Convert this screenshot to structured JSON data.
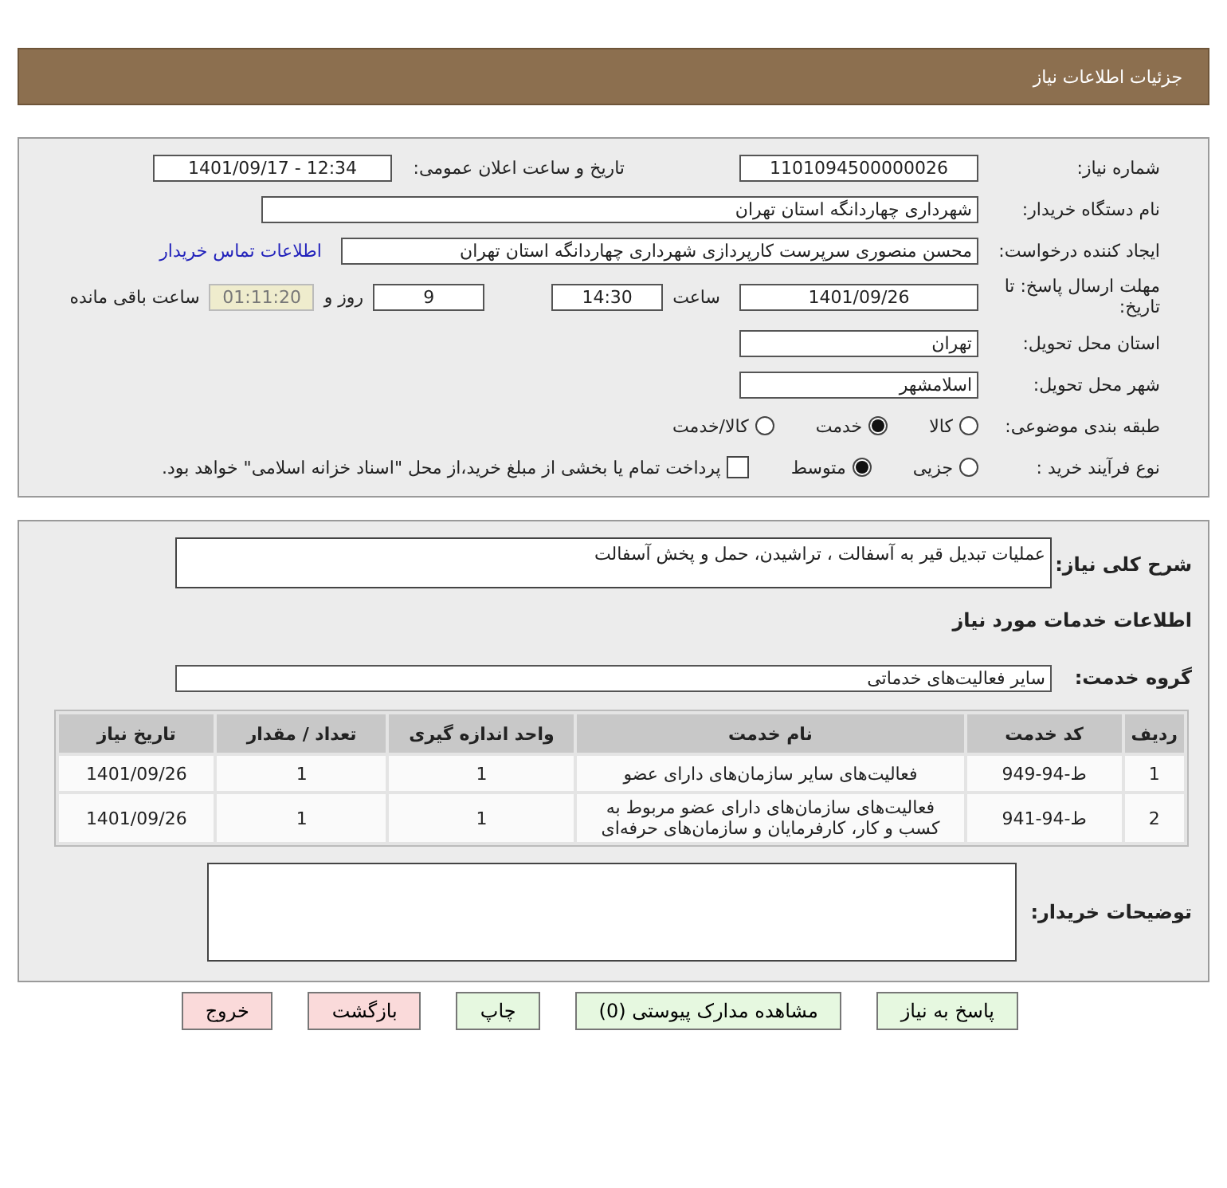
{
  "header": {
    "title": "جزئیات اطلاعات نیاز"
  },
  "details": {
    "need_number": {
      "label": "شماره نیاز:",
      "value": "1101094500000026"
    },
    "announce": {
      "label": "تاریخ و ساعت اعلان عمومی:",
      "value": "1401/09/17 - 12:34"
    },
    "buyer": {
      "label": "نام دستگاه خریدار:",
      "value": "شهرداری چهاردانگه استان تهران"
    },
    "creator": {
      "label": "ایجاد کننده درخواست:",
      "value": "محسن منصوری سرپرست کارپردازی شهرداری چهاردانگه استان تهران",
      "link": "اطلاعات تماس خریدار"
    },
    "deadline": {
      "label": "مهلت ارسال پاسخ: تا تاریخ:",
      "date": "1401/09/26",
      "time_label": "ساعت",
      "time": "14:30",
      "days": "9",
      "days_label": "روز و",
      "remaining": "01:11:20",
      "remaining_label": "ساعت باقی مانده"
    },
    "province": {
      "label": "استان محل تحویل:",
      "value": "تهران"
    },
    "city": {
      "label": "شهر محل تحویل:",
      "value": "اسلامشهر"
    },
    "category": {
      "label": "طبقه بندی موضوعی:",
      "options": [
        {
          "label": "کالا",
          "selected": false
        },
        {
          "label": "خدمت",
          "selected": true
        },
        {
          "label": "کالا/خدمت",
          "selected": false
        }
      ]
    },
    "process": {
      "label": "نوع فرآیند خرید :",
      "options": [
        {
          "label": "جزیی",
          "selected": false
        },
        {
          "label": "متوسط",
          "selected": true
        }
      ],
      "treasury": {
        "label": "پرداخت تمام یا بخشی از مبلغ خرید،از محل \"اسناد خزانه اسلامی\" خواهد بود.",
        "checked": false
      }
    }
  },
  "need": {
    "summary_label": "شرح کلی نیاز:",
    "summary": "عملیات تبدیل قیر به آسفالت ، تراشیدن، حمل و پخش آسفالت",
    "services_heading": "اطلاعات خدمات مورد نیاز",
    "group_label": "گروه خدمت:",
    "group": "سایر فعالیت‌های خدماتی",
    "table": {
      "columns": [
        "ردیف",
        "کد خدمت",
        "نام خدمت",
        "واحد اندازه گیری",
        "تعداد / مقدار",
        "تاریخ نیاز"
      ],
      "rows": [
        [
          "1",
          "ط-94-949",
          "فعالیت‌های سایر سازمان‌های دارای عضو",
          "1",
          "1",
          "1401/09/26"
        ],
        [
          "2",
          "ط-94-941",
          "فعالیت‌های سازمان‌های دارای عضو مربوط به کسب و کار، کارفرمایان و سازمان‌های حرفه‌ای",
          "1",
          "1",
          "1401/09/26"
        ]
      ]
    },
    "notes_label": "توضیحات خریدار:"
  },
  "buttons": [
    {
      "label": "پاسخ به نیاز",
      "kind": "green"
    },
    {
      "label": "مشاهده مدارک پیوستی (0)",
      "kind": "green"
    },
    {
      "label": "چاپ",
      "kind": "green"
    },
    {
      "label": "بازگشت",
      "kind": "red"
    },
    {
      "label": "خروج",
      "kind": "red"
    }
  ]
}
